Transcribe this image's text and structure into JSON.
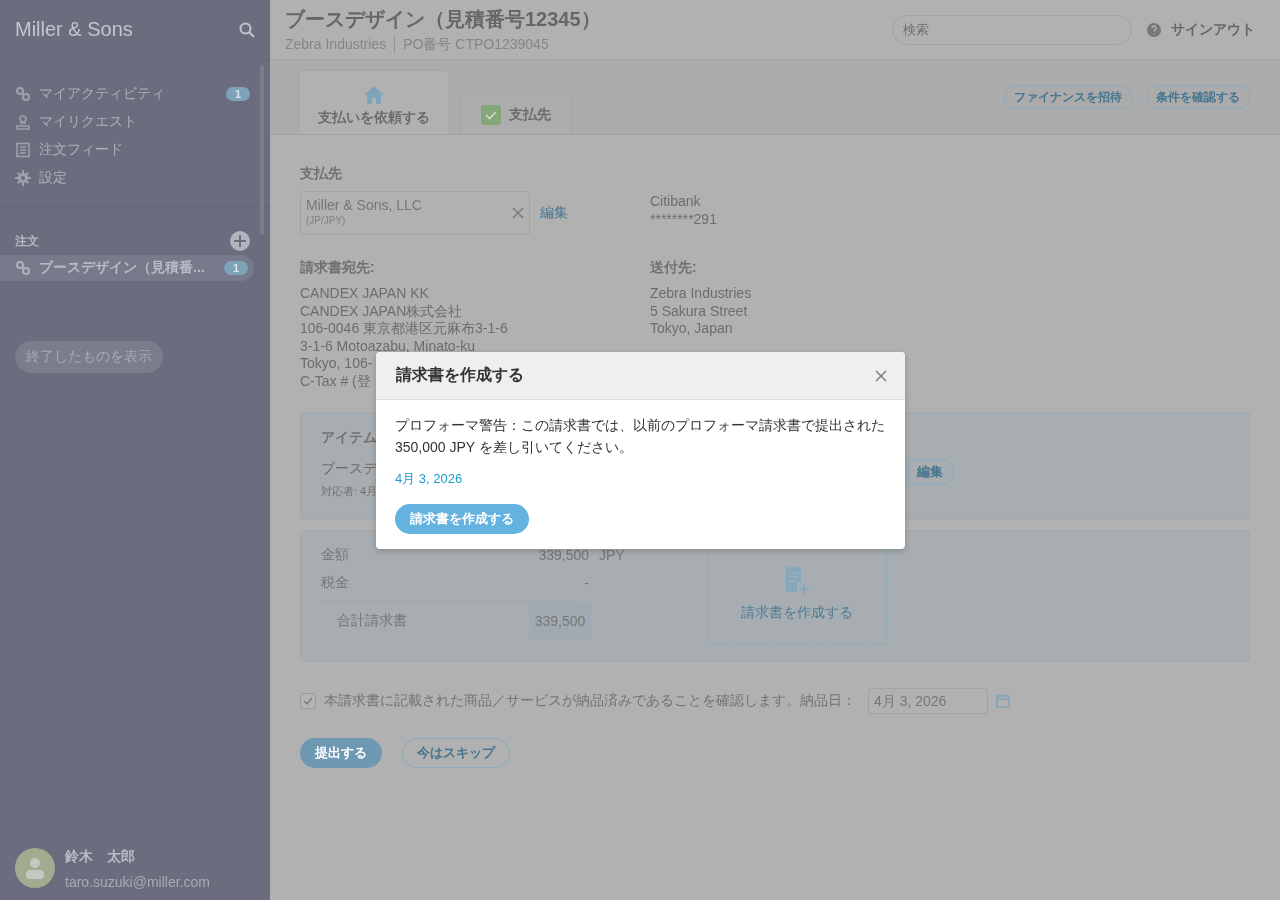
{
  "sidebar": {
    "brand": "Miller & Sons",
    "nav": [
      {
        "kind": "link",
        "label": "マイアクティビティ",
        "badge": "1"
      },
      {
        "kind": "stamp",
        "label": "マイリクエスト"
      },
      {
        "kind": "list",
        "label": "注文フィード"
      },
      {
        "kind": "gear",
        "label": "設定"
      }
    ],
    "section": "注文",
    "orders": [
      {
        "label": "ブースデザイン（見積番...",
        "badge": "1",
        "selected": true
      }
    ],
    "show_closed": "終了したものを表示",
    "user": {
      "name": "鈴木　太郎",
      "email": "taro.suzuki@miller.com"
    }
  },
  "header": {
    "title": "ブースデザイン（見積番号12345）",
    "company": "Zebra Industries",
    "po": "PO番号  CTPO1239045",
    "search": {
      "placeholder": "検索"
    },
    "sign_out": "サインアウト"
  },
  "tabs": [
    {
      "kind": "home",
      "label": "支払いを依頼する",
      "selected": true
    },
    {
      "kind": "check",
      "label": "支払先",
      "selected": false
    }
  ],
  "tab_actions": [
    "ファイナンスを招待",
    "条件を確認する"
  ],
  "payee": {
    "heading": "支払先",
    "name": "Miller & Sons, LLC",
    "currency": "(JP/JPY)",
    "edit": "編集",
    "bank": "Citibank",
    "account": "********291"
  },
  "bill_to": {
    "heading": "請求書宛先:",
    "lines": [
      "CANDEX JAPAN KK",
      "CANDEX JAPAN株式会社",
      "106-0046 東京都港区元麻布3-1-6",
      "3-1-6 Motoazabu, Minato-ku",
      "Tokyo, 106-",
      "C-Tax # (登"
    ]
  },
  "ship_to": {
    "heading": "送付先:",
    "lines": [
      "Zebra Industries",
      "5 Sakura Street",
      "Tokyo, Japan"
    ]
  },
  "items": {
    "heading": "アイテム",
    "name": "ブースデ",
    "owner": "対応者: 4月",
    "edit": "編集"
  },
  "totals": {
    "amount_label": "金額",
    "amount": "339,500",
    "currency": "JPY",
    "tax_label": "税金",
    "tax": "-",
    "total_label": "合計請求書",
    "total": "339,500",
    "create": "請求書を作成する"
  },
  "confirm": {
    "checked": true,
    "label": "本請求書に記載された商品／サービスが納品済みであることを確認します。納品日：",
    "date": "4月 3, 2026"
  },
  "actions": {
    "submit": "提出する",
    "skip": "今はスキップ"
  },
  "modal": {
    "title": "請求書を作成する",
    "message": "プロフォーマ警告：この請求書では、以前のプロフォーマ請求書で提出された350,000 JPY を差し引いてください。",
    "date": "4月 3, 2026",
    "button": "請求書を作成する"
  }
}
